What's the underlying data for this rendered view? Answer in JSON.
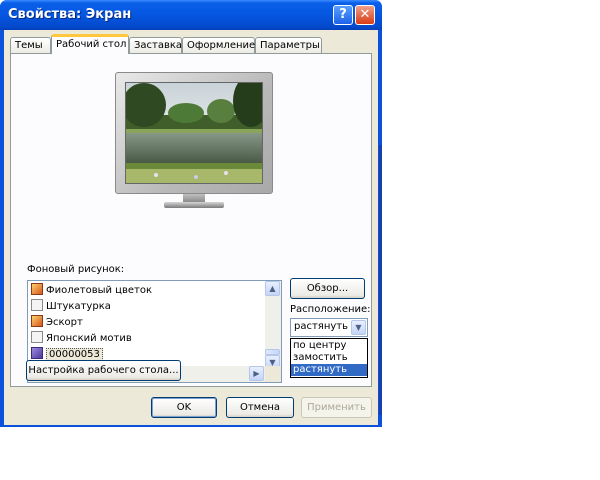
{
  "window": {
    "title": "Свойства: Экран",
    "help_label": "?",
    "close_label": "✕"
  },
  "tabs": [
    {
      "label": "Темы"
    },
    {
      "label": "Рабочий стол"
    },
    {
      "label": "Заставка"
    },
    {
      "label": "Оформление"
    },
    {
      "label": "Параметры"
    }
  ],
  "active_tab": "Рабочий стол",
  "background": {
    "label": "Фоновый рисунок:",
    "items": [
      {
        "label": "Фиолетовый цветок",
        "icon": "orange-image-icon"
      },
      {
        "label": "Штукатурка",
        "icon": "document-icon"
      },
      {
        "label": "Эскорт",
        "icon": "orange-image-icon"
      },
      {
        "label": "Японский мотив",
        "icon": "document-icon"
      },
      {
        "label": "00000053",
        "icon": "purple-image-icon"
      }
    ],
    "selected": "00000053"
  },
  "browse_label": "Обзор...",
  "position": {
    "label": "Расположение:",
    "value": "растянуть",
    "options": [
      "по центру",
      "замостить",
      "растянуть"
    ]
  },
  "customize_label": "Настройка рабочего стола...",
  "footer": {
    "ok_label": "OK",
    "cancel_label": "Отмена",
    "apply_label": "Применить"
  },
  "scroll_grip": "|||",
  "colors": {
    "titlebar": "#0556e0",
    "selection": "#316ac5",
    "tab_highlight": "#ffc83c"
  }
}
